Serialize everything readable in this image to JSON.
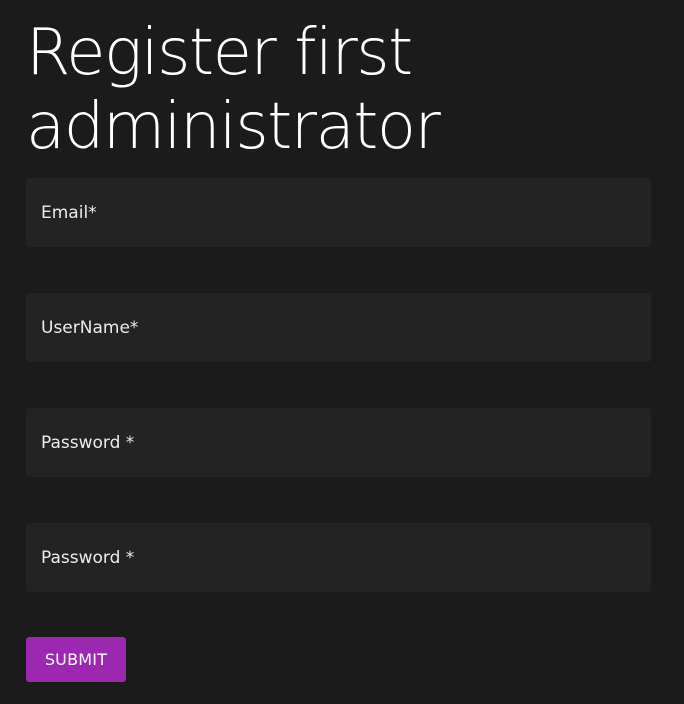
{
  "page": {
    "title_line1": "Register first",
    "title_line2": "administrator"
  },
  "form": {
    "fields": [
      {
        "placeholder": "Email*",
        "value": ""
      },
      {
        "placeholder": "UserName*",
        "value": ""
      },
      {
        "placeholder": "Password *",
        "value": ""
      },
      {
        "placeholder": "Password *",
        "value": ""
      }
    ],
    "submit_label": "SUBMIT"
  },
  "colors": {
    "background": "#1b1b1b",
    "field_background": "#232323",
    "accent": "#9c27b0"
  }
}
